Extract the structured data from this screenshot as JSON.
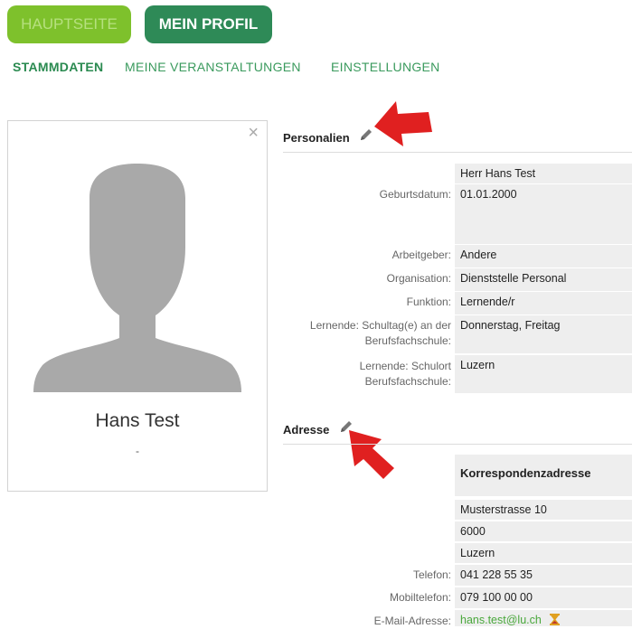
{
  "nav": {
    "home": "HAUPTSEITE",
    "profile": "MEIN PROFIL"
  },
  "tabs": [
    {
      "label": "STAMMDATEN"
    },
    {
      "label": "MEINE VERANSTALTUNGEN"
    },
    {
      "label": "EINSTELLUNGEN"
    }
  ],
  "card": {
    "name": "Hans Test",
    "sub": "-",
    "close": "×"
  },
  "personalien": {
    "title": "Personalien",
    "name_value": "Herr Hans Test",
    "rows": [
      {
        "label": "Geburtsdatum:",
        "value": "01.01.2000"
      },
      {
        "label": "Arbeitgeber:",
        "value": "Andere"
      },
      {
        "label": "Organisation:",
        "value": "Dienststelle Personal"
      },
      {
        "label": "Funktion:",
        "value": "Lernende/r"
      },
      {
        "label": "Lernende: Schultag(e) an der Berufsfachschule:",
        "value": "Donnerstag, Freitag"
      },
      {
        "label": "Lernende: Schulort Berufsfachschule:",
        "value": "Luzern"
      }
    ]
  },
  "adresse": {
    "title": "Adresse",
    "heading": "Korrespondenzadresse",
    "street": "Musterstrasse 10",
    "zip": "6000",
    "city": "Luzern",
    "rows": [
      {
        "label": "Telefon:",
        "value": "041 228 55 35"
      },
      {
        "label": "Mobiltelefon:",
        "value": "079 100 00 00"
      },
      {
        "label": "E-Mail-Adresse:",
        "value": "hans.test@lu.ch"
      }
    ]
  },
  "colors": {
    "home": "#7ec12c",
    "profile": "#2e8a57",
    "accent": "#3a9a5d",
    "arrow": "#e02020"
  }
}
